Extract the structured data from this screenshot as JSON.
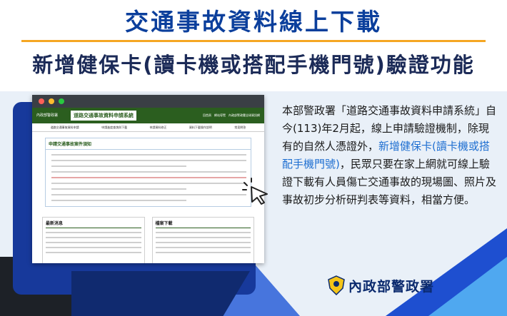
{
  "header": {
    "title": "交通事故資料線上下載",
    "subtitle": "新增健保卡(讀卡機或搭配手機門號)驗證功能"
  },
  "browser_window": {
    "site_header_logo": "內政部警政署",
    "site_title": "道路交通事故資料申請系統",
    "site_links": [
      "回首頁",
      "網站導覽",
      "內政部警政署全球資訊網"
    ],
    "nav_items": [
      "道路交通事故資料申請",
      "申請進度查詢與下載",
      "申請資料修正",
      "資料下載操作說明",
      "常見問答"
    ],
    "notice_title": "申請交通事故案件須知",
    "news_title": "最新消息",
    "files_title": "檔案下載"
  },
  "description": {
    "part1": "本部警政署「道路交通事故資料申請系統」自今(113)年2月起，線上申請驗證機制，除現有的自然人憑證外，",
    "highlight": "新增健保卡(讀卡機或搭配手機門號)",
    "part2": "，民眾只要在家上網就可線上驗證下載有人員傷亡交通事故的現場圖、照片及事故初步分析研判表等資料，相當方便。"
  },
  "brand": {
    "name": "內政部警政署"
  },
  "colors": {
    "title_blue": "#0b3f9c",
    "accent_orange": "#f5a623",
    "highlight_blue": "#1f6fd1",
    "site_green": "#2b5e1f",
    "monitor_blue": "#17399b"
  },
  "icons": [
    "cursor-icon",
    "police-badge-icon"
  ]
}
